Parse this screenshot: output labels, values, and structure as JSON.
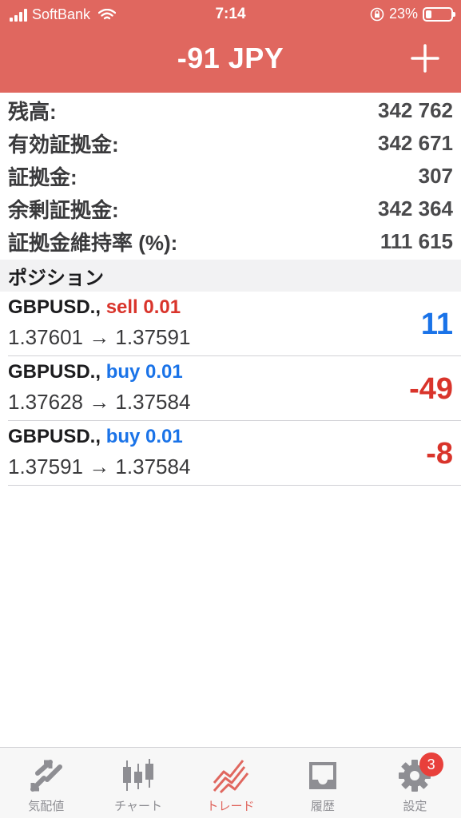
{
  "status_bar": {
    "carrier": "SoftBank",
    "time": "7:14",
    "battery": "23%",
    "battery_level": 0.23
  },
  "header": {
    "title": "-91 JPY"
  },
  "summary": [
    {
      "label": "残高:",
      "value": "342 762"
    },
    {
      "label": "有効証拠金:",
      "value": "342 671"
    },
    {
      "label": "証拠金:",
      "value": "307"
    },
    {
      "label": "余剰証拠金:",
      "value": "342 364"
    },
    {
      "label": "証拠金維持率 (%):",
      "value": "111 615"
    }
  ],
  "positions_section": {
    "title": "ポジション"
  },
  "positions": [
    {
      "symbol": "GBPUSD.,",
      "side": "sell 0.01",
      "prices": "1.37601 → 1.37591",
      "profit": "11"
    },
    {
      "symbol": "GBPUSD.,",
      "side": "buy 0.01",
      "prices": "1.37628 → 1.37584",
      "profit": "-49"
    },
    {
      "symbol": "GBPUSD.,",
      "side": "buy 0.01",
      "prices": "1.37591 → 1.37584",
      "profit": "-8"
    }
  ],
  "tabs": [
    {
      "label": "気配値",
      "icon": "quotes-icon"
    },
    {
      "label": "チャート",
      "icon": "chart-candles-icon"
    },
    {
      "label": "トレード",
      "icon": "trade-icon",
      "active": true
    },
    {
      "label": "履歴",
      "icon": "history-inbox-icon"
    },
    {
      "label": "設定",
      "icon": "gear-icon",
      "badge": "3"
    }
  ],
  "colors": {
    "header": "#e0675f",
    "sell": "#d9342b",
    "buy": "#1a73e8",
    "inactive_tab": "#8e8e93"
  }
}
